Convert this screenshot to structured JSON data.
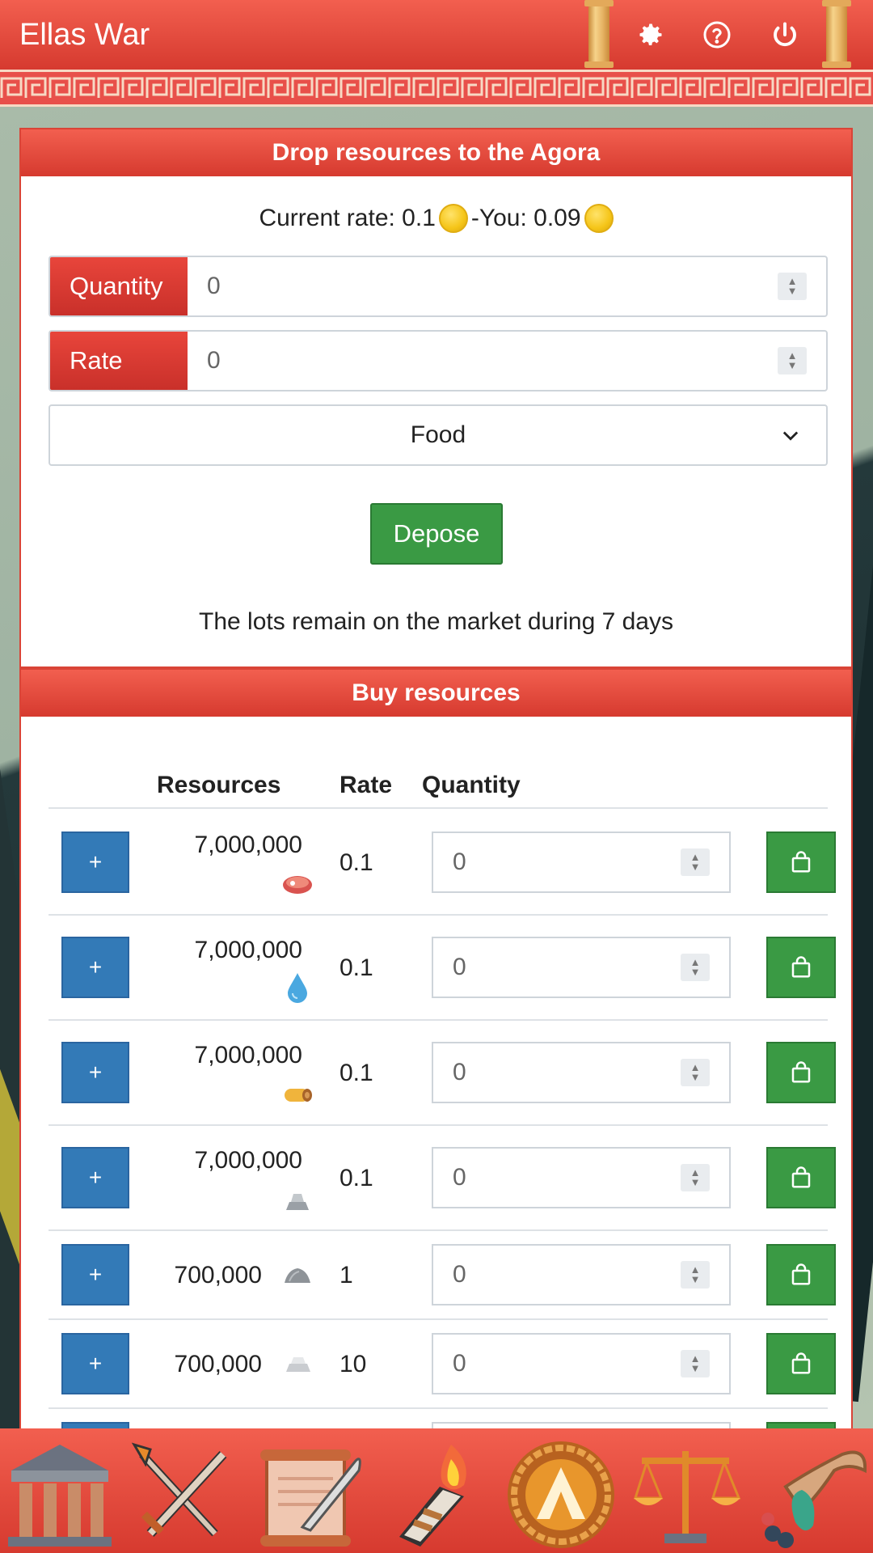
{
  "header": {
    "title": "Ellas War",
    "icons": [
      "column-icon",
      "gear-icon",
      "help-icon",
      "power-icon",
      "column-icon"
    ]
  },
  "drop_panel": {
    "title": "Drop resources to the Agora",
    "rate_prefix": "Current rate: 0.1",
    "rate_sep": "-You: 0.09",
    "quantity_label": "Quantity",
    "quantity_value": "0",
    "rate_label": "Rate",
    "rate_value": "0",
    "resource_selected": "Food",
    "depose_label": "Depose",
    "notice": "The lots remain on the market during 7 days"
  },
  "buy_panel": {
    "title": "Buy resources",
    "columns": {
      "resources": "Resources",
      "rate": "Rate",
      "quantity": "Quantity"
    },
    "rows": [
      {
        "amount": "7,000,000",
        "icon": "meat-icon",
        "rate": "0.1",
        "qty": "0",
        "plus": "+"
      },
      {
        "amount": "7,000,000",
        "icon": "water-icon",
        "rate": "0.1",
        "qty": "0",
        "plus": "+"
      },
      {
        "amount": "7,000,000",
        "icon": "wood-icon",
        "rate": "0.1",
        "qty": "0",
        "plus": "+"
      },
      {
        "amount": "7,000,000",
        "icon": "iron-icon",
        "rate": "0.1",
        "qty": "0",
        "plus": "+"
      },
      {
        "amount": "700,000",
        "icon": "stone-icon",
        "rate": "1",
        "qty": "0",
        "plus": "+"
      },
      {
        "amount": "700,000",
        "icon": "silver-icon",
        "rate": "10",
        "qty": "0",
        "plus": "+"
      }
    ]
  },
  "bottom_nav": [
    "temple-icon",
    "swords-icon",
    "scroll-icon",
    "torch-icon",
    "shield-icon",
    "scales-icon",
    "cornucopia-icon"
  ],
  "colors": {
    "red": "#d63a2f",
    "green": "#3a9a44",
    "blue": "#337ab7"
  }
}
